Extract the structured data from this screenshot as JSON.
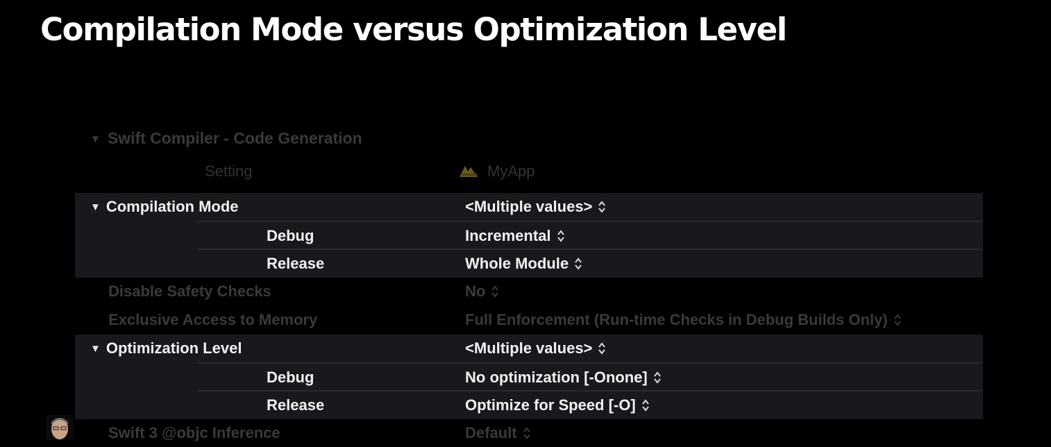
{
  "title": "Compilation Mode versus Optimization Level",
  "section_header": "Swift Compiler - Code Generation",
  "columns": {
    "setting": "Setting",
    "target": "MyApp"
  },
  "compilation_mode": {
    "label": "Compilation Mode",
    "value": "<Multiple values>",
    "debug_label": "Debug",
    "debug_value": "Incremental",
    "release_label": "Release",
    "release_value": "Whole Module"
  },
  "disable_safety_checks": {
    "label": "Disable Safety Checks",
    "value": "No"
  },
  "exclusive_access": {
    "label": "Exclusive Access to Memory",
    "value": "Full Enforcement (Run-time Checks in Debug Builds Only)"
  },
  "optimization_level": {
    "label": "Optimization Level",
    "value": "<Multiple values>",
    "debug_label": "Debug",
    "debug_value": "No optimization [-Onone]",
    "release_label": "Release",
    "release_value": "Optimize for Speed [-O]"
  },
  "objc_inference": {
    "label": "Swift 3 @objc Inference",
    "value": "Default"
  },
  "icons": {
    "disclosure": "disclosure-triangle-icon",
    "stepper": "up-down-stepper-icon",
    "target": "app-target-icon",
    "presenter": "presenter-video-inset"
  },
  "colors": {
    "background": "#000000",
    "selected_group": "#17191d",
    "dimmed_text": "#3a3a3a"
  }
}
